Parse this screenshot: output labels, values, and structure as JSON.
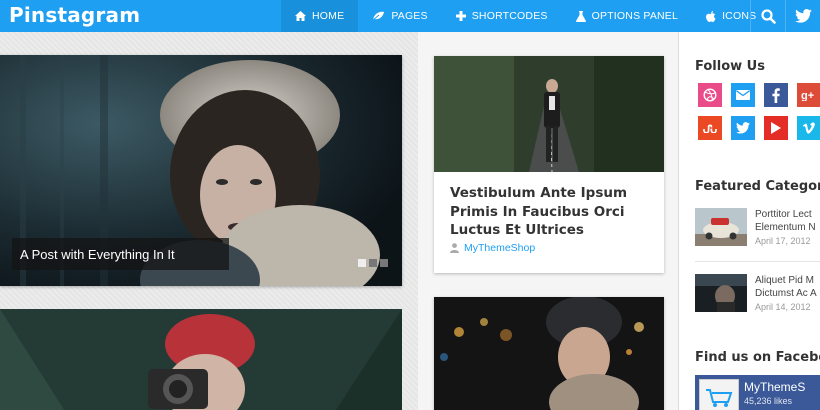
{
  "header": {
    "logo": "Pinstagram",
    "nav": [
      {
        "label": "Home",
        "icon": "home-icon",
        "active": true
      },
      {
        "label": "Pages",
        "icon": "leaf-icon",
        "active": false
      },
      {
        "label": "Shortcodes",
        "icon": "plus-icon",
        "active": false
      },
      {
        "label": "Options Panel",
        "icon": "flask-icon",
        "active": false
      },
      {
        "label": "Icons",
        "icon": "apple-icon",
        "active": false
      }
    ],
    "search_icon": "search-icon",
    "twitter_icon": "twitter-icon"
  },
  "slider": {
    "caption": "A Post with Everything In It",
    "slides": 3,
    "active_slide": 1
  },
  "card": {
    "title": "Vestibulum Ante Ipsum Primis In Faucibus Orci Luctus Et Ultrices",
    "author": "MyThemeShop"
  },
  "sidebar": {
    "follow_title": "Follow Us",
    "social": [
      {
        "name": "dribbble",
        "color": "#ea4c89"
      },
      {
        "name": "email",
        "color": "#1e9ff2"
      },
      {
        "name": "facebook",
        "color": "#3b5998"
      },
      {
        "name": "google-plus",
        "color": "#dd4b39"
      },
      {
        "name": "stumbleupon",
        "color": "#eb4924"
      },
      {
        "name": "twitter",
        "color": "#1e9ff2"
      },
      {
        "name": "youtube",
        "color": "#e52d27"
      },
      {
        "name": "vimeo",
        "color": "#1ab7ea"
      }
    ],
    "featured_title": "Featured Category",
    "featured": [
      {
        "title_line1": "Porttitor Lect",
        "title_line2": "Elementum N",
        "date": "April 17, 2012"
      },
      {
        "title_line1": "Aliquet Pid M",
        "title_line2": "Dictumst Ac A",
        "date": "April 14, 2012"
      }
    ],
    "facebook_title": "Find us on Facebook",
    "facebook_page": "MyThemeS",
    "facebook_likes": "45,236 likes"
  }
}
